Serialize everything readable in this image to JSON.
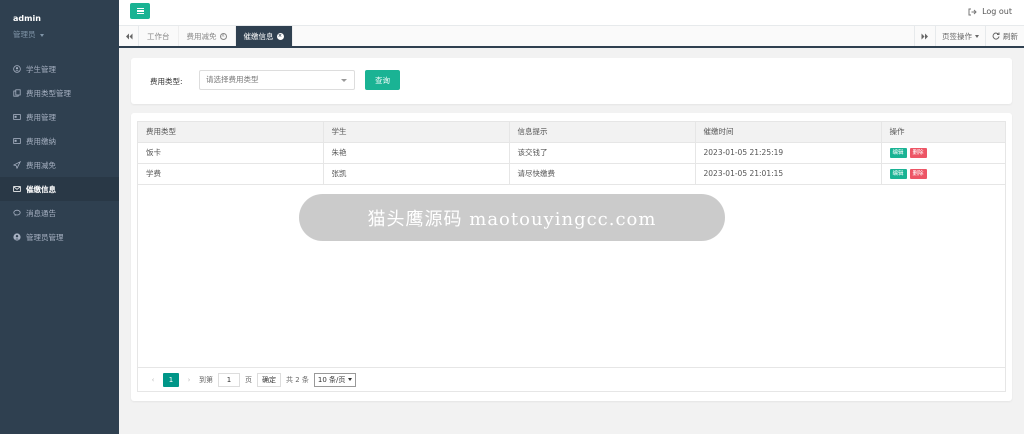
{
  "user": {
    "name": "admin",
    "role": "管理员"
  },
  "sidebar": {
    "items": [
      {
        "label": "学生管理",
        "icon": "user-icon"
      },
      {
        "label": "费用类型管理",
        "icon": "copy-icon"
      },
      {
        "label": "费用管理",
        "icon": "card-icon"
      },
      {
        "label": "费用缴纳",
        "icon": "card-icon"
      },
      {
        "label": "费用减免",
        "icon": "send-icon"
      },
      {
        "label": "催缴信息",
        "icon": "mail-icon",
        "active": true
      },
      {
        "label": "消息通告",
        "icon": "chat-icon"
      },
      {
        "label": "管理员管理",
        "icon": "user-circle-icon"
      }
    ]
  },
  "topbar": {
    "logout_label": "Log out"
  },
  "tabs": {
    "items": [
      {
        "label": "工作台"
      },
      {
        "label": "费用减免"
      },
      {
        "label": "催缴信息",
        "active": true
      }
    ],
    "page_ops_label": "页签操作",
    "refresh_label": "刷新"
  },
  "search": {
    "label": "费用类型:",
    "placeholder": "请选择费用类型",
    "query_label": "查询"
  },
  "table": {
    "headers": [
      "费用类型",
      "学生",
      "信息提示",
      "催缴时间",
      "操作"
    ],
    "rows": [
      {
        "type": "饭卡",
        "student": "朱艳",
        "message": "该交钱了",
        "time": "2023-01-05 21:25:19"
      },
      {
        "type": "学费",
        "student": "张凯",
        "message": "请尽快缴费",
        "time": "2023-01-05 21:01:15"
      }
    ],
    "edit_label": "编辑",
    "delete_label": "删除"
  },
  "pager": {
    "current_page": "1",
    "goto_label": "到第",
    "page_input": "1",
    "page_unit": "页",
    "confirm_label": "确定",
    "total_label": "共 2 条",
    "page_size": "10 条/页"
  },
  "banner": {
    "text": "猫头鹰源码 maotouyingcc.com"
  },
  "colors": {
    "sidebar": "#2f4050",
    "accent": "#1ab394",
    "danger": "#ed5565"
  }
}
